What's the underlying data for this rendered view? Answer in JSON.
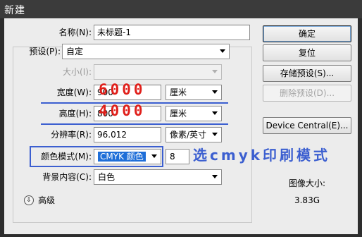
{
  "window": {
    "title": "新建"
  },
  "form": {
    "name_label": "名称(N):",
    "name_value": "未标题-1",
    "preset_label": "预设(P):",
    "preset_value": "自定",
    "size_label": "大小(I):",
    "width_label": "宽度(W):",
    "width_value": "900",
    "width_unit": "厘米",
    "height_label": "高度(H):",
    "height_value": "800",
    "height_unit": "厘米",
    "resolution_label": "分辨率(R):",
    "resolution_value": "96.012",
    "resolution_unit": "像素/英寸",
    "color_mode_label": "颜色模式(M):",
    "color_mode_value": "CMYK 颜色",
    "bit_depth_value": "8",
    "background_label": "背景内容(C):",
    "background_value": "白色",
    "advanced_label": "高级"
  },
  "buttons": {
    "ok": "确定",
    "reset": "复位",
    "save_preset": "存储预设(S)...",
    "delete_preset": "删除预设(D)...",
    "device_central": "Device Central(E)..."
  },
  "info": {
    "image_size_label": "图像大小:",
    "image_size_value": "3.83G"
  },
  "annotations": {
    "width_handwritten": "6000",
    "height_handwritten": "4000",
    "color_mode_note": "选cmyk印刷模式"
  },
  "colors": {
    "selection": "#1e6ed8",
    "handwriting_red": "#e0201b",
    "annotation_blue": "#3c5fd0"
  }
}
